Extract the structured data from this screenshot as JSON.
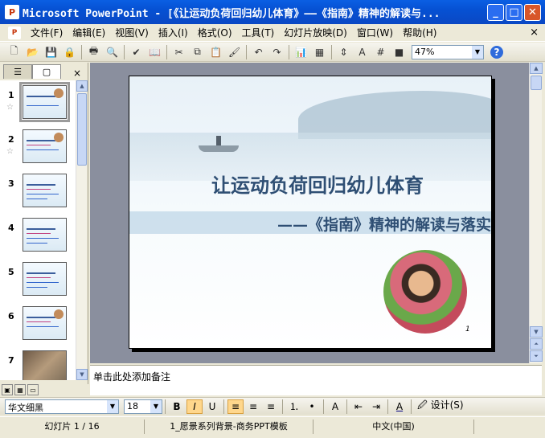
{
  "window": {
    "title": "Microsoft PowerPoint - [《让运动负荷回归幼儿体育》——《指南》精神的解读与...",
    "app_icon_glyph": "P"
  },
  "menubar": {
    "items": [
      "文件(F)",
      "编辑(E)",
      "视图(V)",
      "插入(I)",
      "格式(O)",
      "工具(T)",
      "幻灯片放映(D)",
      "窗口(W)",
      "帮助(H)"
    ],
    "close_glyph": "×"
  },
  "toolbar": {
    "zoom": "47%",
    "help_glyph": "?"
  },
  "left_pane": {
    "tab_outline_glyph": "☰",
    "tab_slides_glyph": "▢",
    "close_glyph": "×",
    "slides": [
      {
        "number": "1",
        "star": "☆",
        "selected": true
      },
      {
        "number": "2",
        "star": "☆",
        "selected": false
      },
      {
        "number": "3",
        "star": "",
        "selected": false
      },
      {
        "number": "4",
        "star": "",
        "selected": false
      },
      {
        "number": "5",
        "star": "",
        "selected": false
      },
      {
        "number": "6",
        "star": "",
        "selected": false
      },
      {
        "number": "7",
        "star": "",
        "selected": false
      }
    ]
  },
  "slide": {
    "title": "让运动负荷回归幼儿体育",
    "subtitle": "——《指南》精神的解读与落实",
    "page_number": "1"
  },
  "notes": {
    "placeholder": "单击此处添加备注"
  },
  "format_bar": {
    "font_name": "华文细黑",
    "font_size": "18",
    "bold": "B",
    "italic": "I",
    "design_label": "设计(S)"
  },
  "status": {
    "slide_position": "幻灯片 1 / 16",
    "template": "1_愿景系列背景-商务PPT模板",
    "language": "中文(中国)"
  }
}
